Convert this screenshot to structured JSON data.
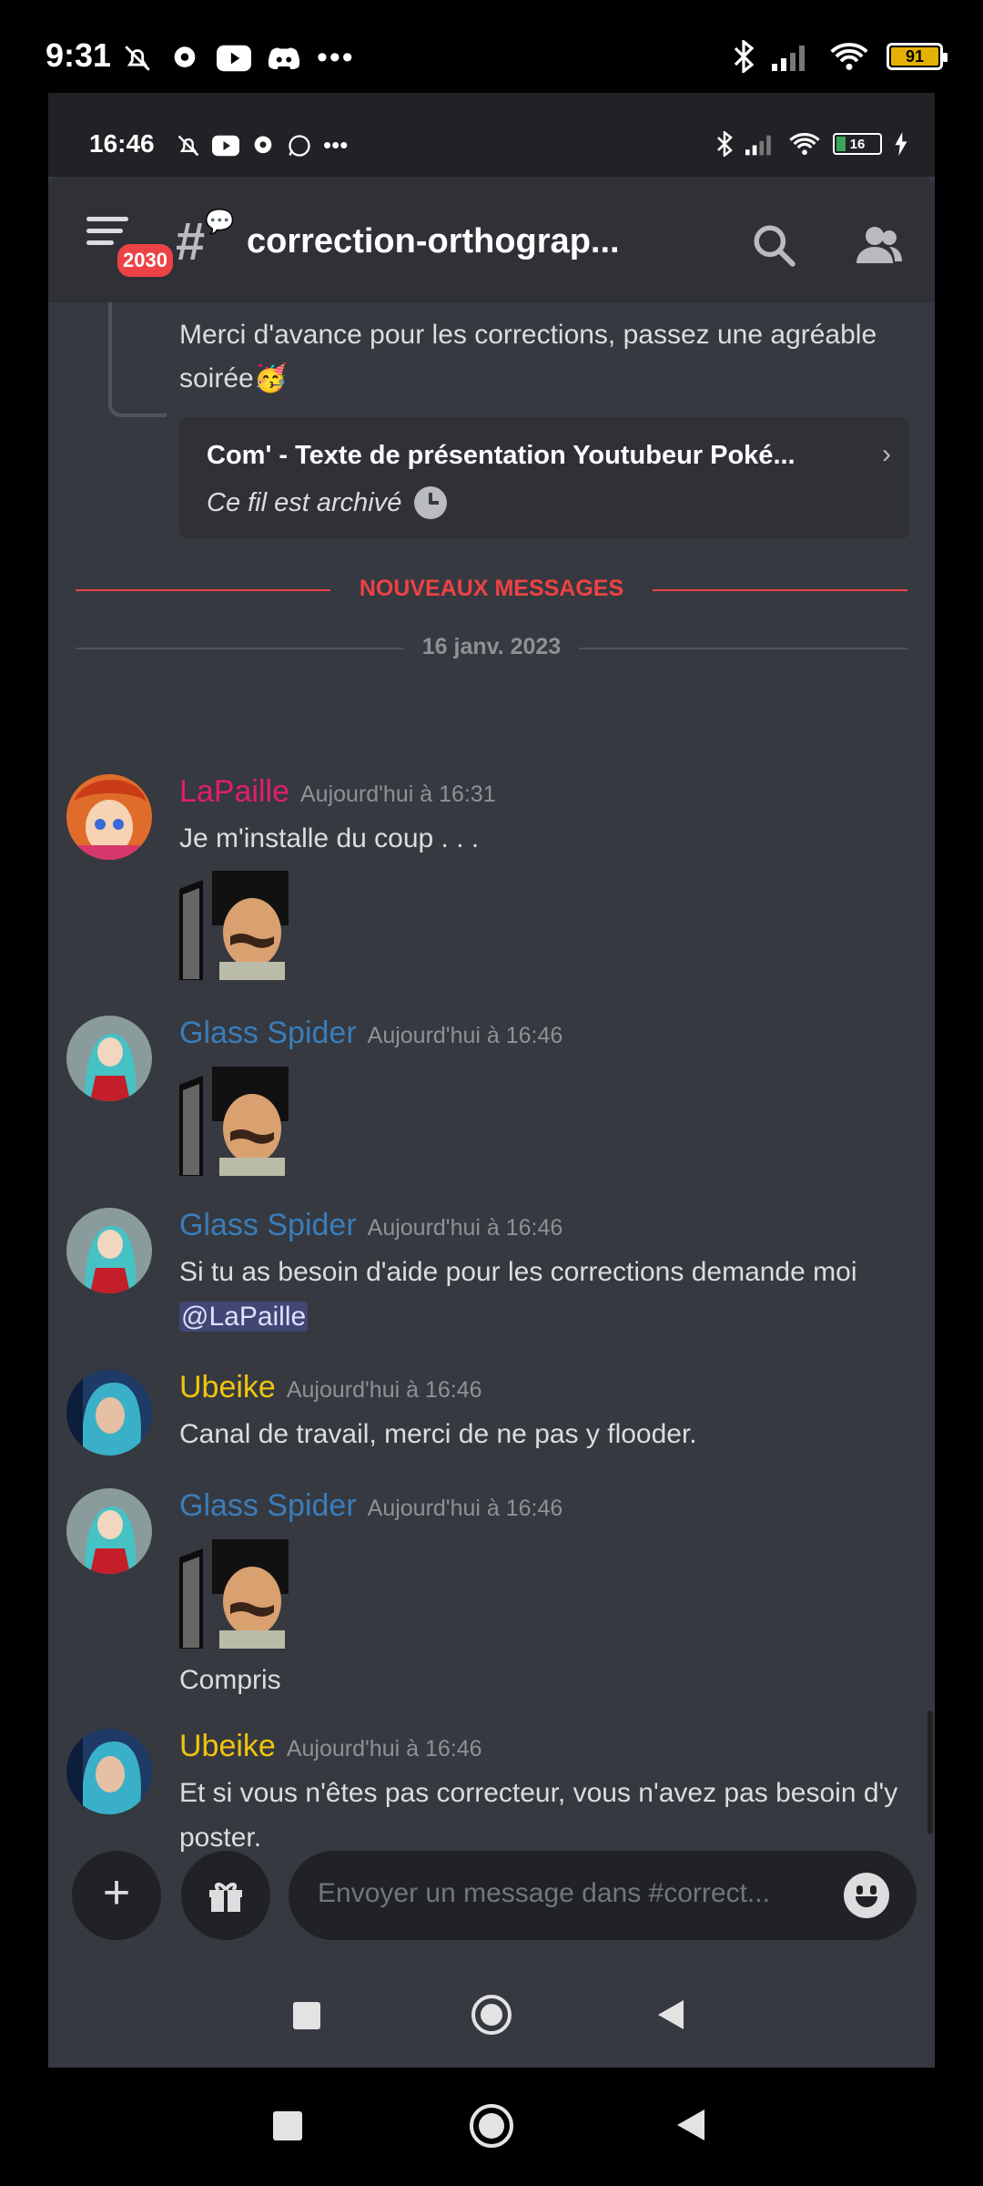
{
  "outer_status": {
    "time": "9:31",
    "battery": "91"
  },
  "inner_status": {
    "time": "16:46",
    "battery": "16"
  },
  "header": {
    "channel_name": "correction-orthograp...",
    "badge": "2030"
  },
  "previous": {
    "text": "Merci d'avance pour les corrections, passez une agréable soirée",
    "emoji": "🥳",
    "thread_title": "Com' - Texte de présentation Youtubeur Poké...",
    "thread_status": "Ce fil est archivé"
  },
  "dividers": {
    "new_messages": "NOUVEAUX MESSAGES",
    "date": "16 janv. 2023"
  },
  "messages": [
    {
      "author": "LaPaille",
      "color": "#e01e6e",
      "time": "Aujourd'hui à 16:31",
      "text": "Je m'installe du coup . . ."
    },
    {
      "author": "Glass Spider",
      "color": "#3a7dbb",
      "time": "Aujourd'hui à 16:46"
    },
    {
      "author": "Glass Spider",
      "color": "#3a7dbb",
      "time": "Aujourd'hui à 16:46",
      "text": "Si tu as besoin d'aide pour les corrections demande moi",
      "mention": "@LaPaille"
    },
    {
      "author": "Ubeike",
      "color": "#f1c40f",
      "time": "Aujourd'hui à 16:46",
      "text": "Canal de travail, merci de ne pas y flooder."
    },
    {
      "author": "Glass Spider",
      "color": "#3a7dbb",
      "time": "Aujourd'hui à 16:46",
      "text": "Compris"
    },
    {
      "author": "Ubeike",
      "color": "#f1c40f",
      "time": "Aujourd'hui à 16:46",
      "text": "Et si vous n'êtes pas correcteur, vous n'avez pas besoin d'y poster."
    }
  ],
  "input": {
    "placeholder": "Envoyer un message dans #correct..."
  }
}
